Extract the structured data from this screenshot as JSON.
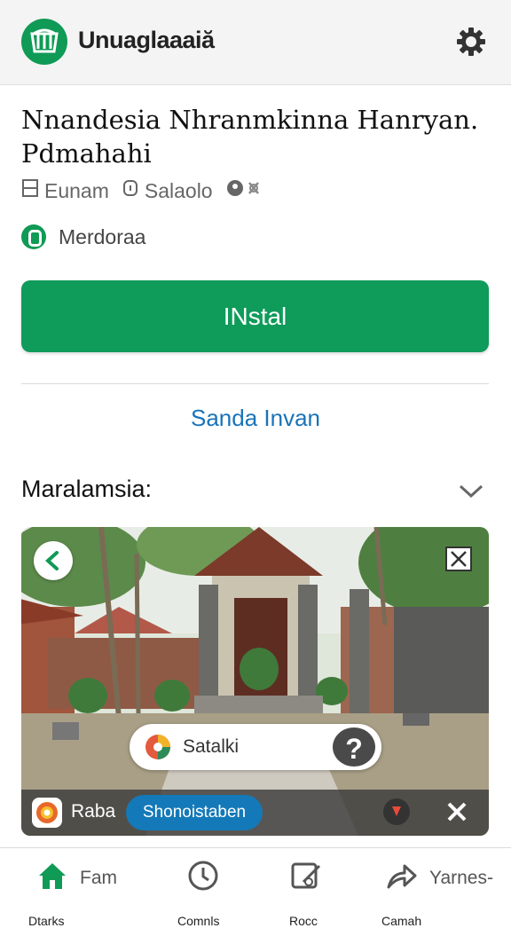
{
  "header": {
    "app_name": "Unuaglaaaiă",
    "logo_icon": "store-logo-icon",
    "settings_icon": "gear-icon",
    "brand_color": "#0f9a55"
  },
  "app": {
    "title": "Nnandesia Nhranmkinna Hanryan. Pdmahahi",
    "meta": [
      {
        "icon": "person-icon",
        "text": "Eunam"
      },
      {
        "icon": "info-icon",
        "text": "Salaolo"
      },
      {
        "icon": "badge-icon",
        "text": ""
      }
    ],
    "developer": "Merdoraa"
  },
  "actions": {
    "install_label": "INstal",
    "secondary_link": "Sanda Invan",
    "link_color": "#1a73b8"
  },
  "section": {
    "title": "Maralamsia:",
    "chevron_icon": "chevron-down-icon"
  },
  "media": {
    "back_icon": "back-arrow-icon",
    "close_icon": "close-icon",
    "pill_label": "Satalki",
    "help_label": "?",
    "bar_label": "Raba",
    "bar_button": "Shonoistaben"
  },
  "nav": [
    {
      "icon": "home-icon",
      "label": "Fam",
      "sub": "Dtarks"
    },
    {
      "icon": "clock-icon",
      "label": "",
      "sub": "Comnls"
    },
    {
      "icon": "edit-icon",
      "label": "",
      "sub": "Rocc"
    },
    {
      "icon": "share-icon",
      "label": "Yarnes-",
      "sub": "Camah"
    }
  ]
}
